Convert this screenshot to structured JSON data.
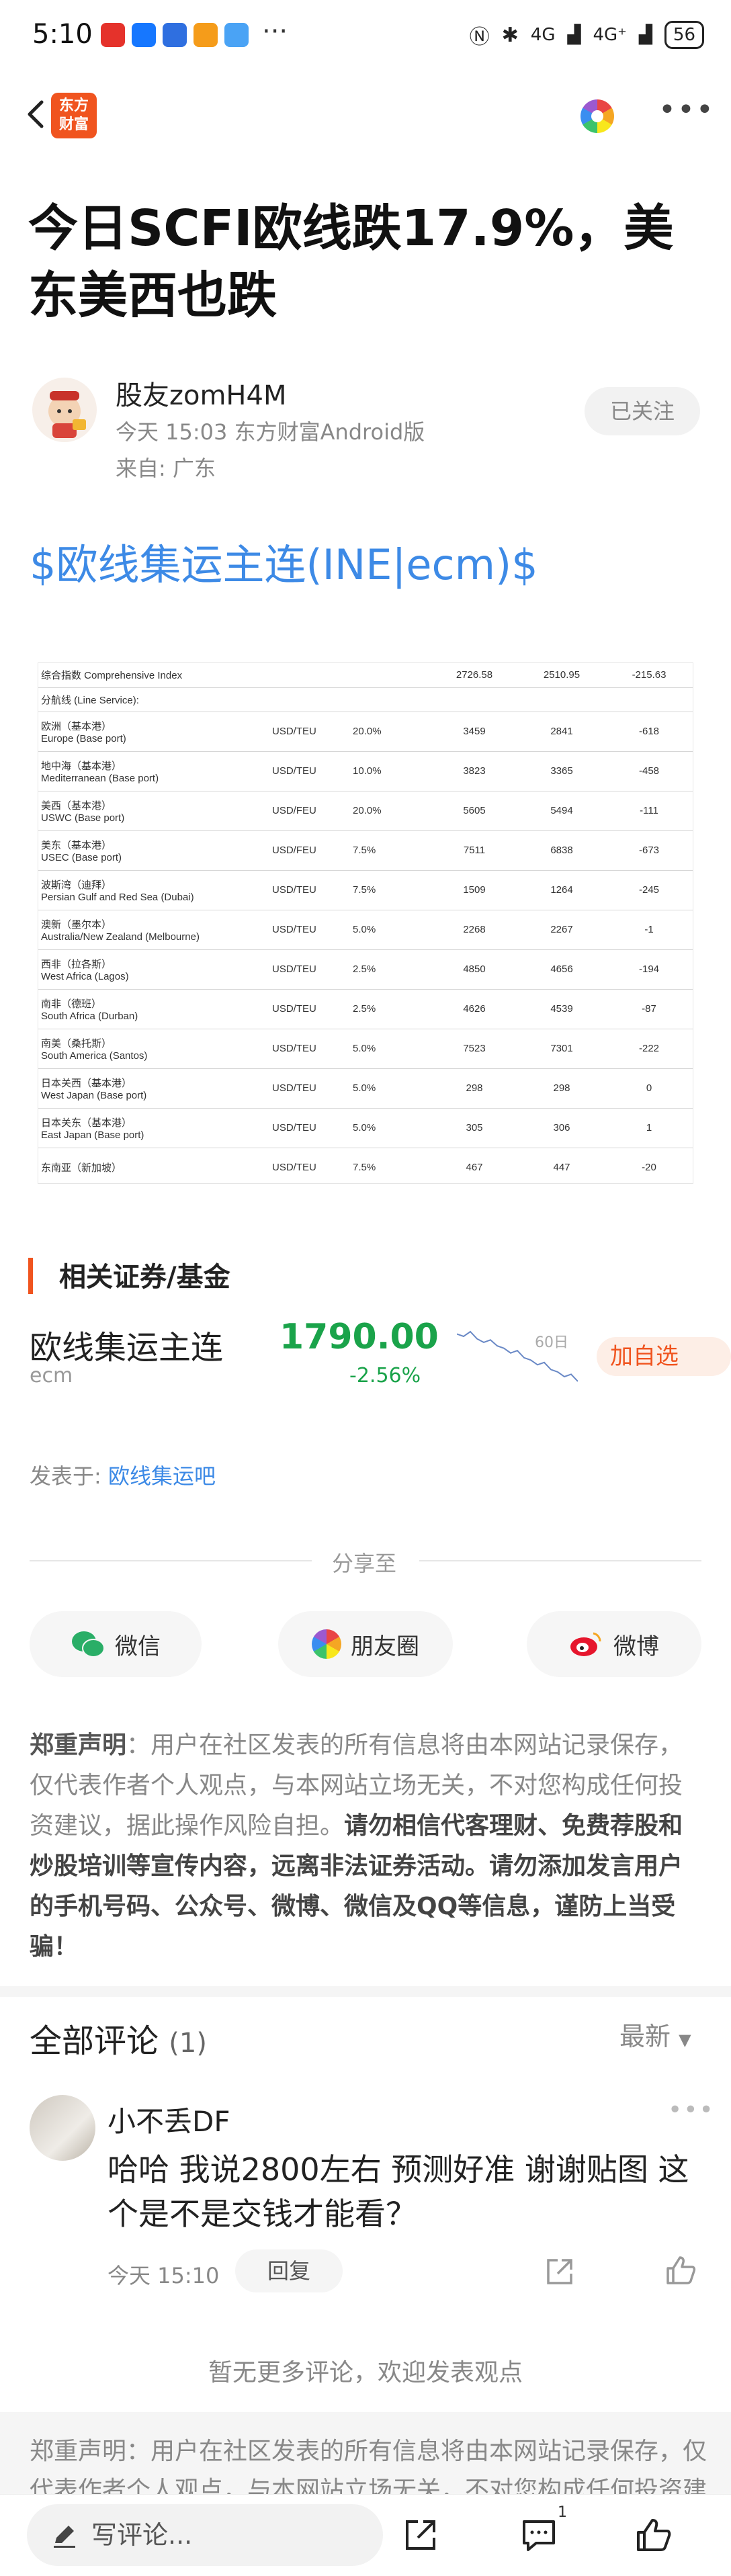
{
  "status_bar": {
    "time": "5:10",
    "more": "···",
    "signal_a": "4G",
    "signal_b": "4G⁺",
    "battery": "56"
  },
  "nav": {
    "logo_text_line1": "东方",
    "logo_text_line2": "财富"
  },
  "article": {
    "title": "今日SCFI欧线跌17.9%，美东美西也跌",
    "author": "股友zomH4M",
    "meta": "今天 15:03 东方财富Android版",
    "from": "来自: 广东",
    "follow_label": "已关注",
    "stock_link": "$欧线集运主连(INE|ecm)$"
  },
  "scfi_table": {
    "composite": {
      "name": "综合指数 Comprehensive Index",
      "cur": "2726.58",
      "prev": "2510.95",
      "chg": "-215.63"
    },
    "section_label": "分航线 (Line Service):",
    "rows": [
      {
        "cn": "欧洲（基本港）",
        "en": "Europe (Base port)",
        "unit": "USD/TEU",
        "weight": "20.0%",
        "cur": "3459",
        "prev": "2841",
        "chg": "-618"
      },
      {
        "cn": "地中海（基本港）",
        "en": "Mediterranean (Base port)",
        "unit": "USD/TEU",
        "weight": "10.0%",
        "cur": "3823",
        "prev": "3365",
        "chg": "-458"
      },
      {
        "cn": "美西（基本港）",
        "en": "USWC (Base port)",
        "unit": "USD/FEU",
        "weight": "20.0%",
        "cur": "5605",
        "prev": "5494",
        "chg": "-111"
      },
      {
        "cn": "美东（基本港）",
        "en": "USEC (Base port)",
        "unit": "USD/FEU",
        "weight": "7.5%",
        "cur": "7511",
        "prev": "6838",
        "chg": "-673"
      },
      {
        "cn": "波斯湾（迪拜）",
        "en": "Persian Gulf and Red Sea (Dubai)",
        "unit": "USD/TEU",
        "weight": "7.5%",
        "cur": "1509",
        "prev": "1264",
        "chg": "-245"
      },
      {
        "cn": "澳新（墨尔本）",
        "en": "Australia/New Zealand (Melbourne)",
        "unit": "USD/TEU",
        "weight": "5.0%",
        "cur": "2268",
        "prev": "2267",
        "chg": "-1"
      },
      {
        "cn": "西非（拉各斯）",
        "en": "West Africa (Lagos)",
        "unit": "USD/TEU",
        "weight": "2.5%",
        "cur": "4850",
        "prev": "4656",
        "chg": "-194"
      },
      {
        "cn": "南非（德班）",
        "en": "South Africa (Durban)",
        "unit": "USD/TEU",
        "weight": "2.5%",
        "cur": "4626",
        "prev": "4539",
        "chg": "-87"
      },
      {
        "cn": "南美（桑托斯）",
        "en": "South America (Santos)",
        "unit": "USD/TEU",
        "weight": "5.0%",
        "cur": "7523",
        "prev": "7301",
        "chg": "-222"
      },
      {
        "cn": "日本关西（基本港）",
        "en": "West Japan (Base port)",
        "unit": "USD/TEU",
        "weight": "5.0%",
        "cur": "298",
        "prev": "298",
        "chg": "0"
      },
      {
        "cn": "日本关东（基本港）",
        "en": "East Japan (Base port)",
        "unit": "USD/TEU",
        "weight": "5.0%",
        "cur": "305",
        "prev": "306",
        "chg": "1"
      },
      {
        "cn": "东南亚（新加坡）",
        "en": "",
        "unit": "USD/TEU",
        "weight": "7.5%",
        "cur": "467",
        "prev": "447",
        "chg": "-20"
      }
    ]
  },
  "related": {
    "title": "相关证券/基金",
    "name": "欧线集运主连",
    "code": "ecm",
    "price": "1790.00",
    "change": "-2.56%",
    "spark_label": "60日",
    "add_button": "加自选",
    "spark_values": [
      62,
      60,
      64,
      58,
      55,
      57,
      52,
      50,
      46,
      48,
      42,
      40,
      36,
      38,
      32,
      30,
      26,
      28,
      22
    ]
  },
  "posted_in": {
    "label": "发表于:",
    "board": "欧线集运吧"
  },
  "share": {
    "label": "分享至",
    "wechat": "微信",
    "moments": "朋友圈",
    "weibo": "微博"
  },
  "disclaimer": {
    "bold": "郑重声明",
    "text": "：用户在社区发表的所有信息将由本网站记录保存，仅代表作者个人观点，与本网站立场无关，不对您构成任何投资建议，据此操作风险自担。",
    "emphasis": "请勿相信代客理财、免费荐股和炒股培训等宣传内容，远离非法证券活动。请勿添加发言用户的手机号码、公众号、微博、微信及QQ等信息，谨防上当受骗！"
  },
  "comments": {
    "header": "全部评论",
    "count": "(1)",
    "sort": "最新",
    "items": [
      {
        "user": "小不丢DF",
        "text": "哈哈 我说2800左右 预测好准 谢谢贴图 这个是不是交钱才能看？",
        "time": "今天 15:10",
        "reply": "回复"
      }
    ],
    "no_more": "暂无更多评论，欢迎发表观点"
  },
  "footer": {
    "disclaimer": "郑重声明：用户在社区发表的所有信息将由本网站记录保存，仅代表作者个人观点，与本网站立场无关，不对您构成任何投资建"
  },
  "bottom_bar": {
    "write_placeholder": "写评论...",
    "comment_count": "1"
  },
  "colors": {
    "accent": "#f0541f",
    "link": "#3d8ae6",
    "down_green": "#1aa34a"
  }
}
